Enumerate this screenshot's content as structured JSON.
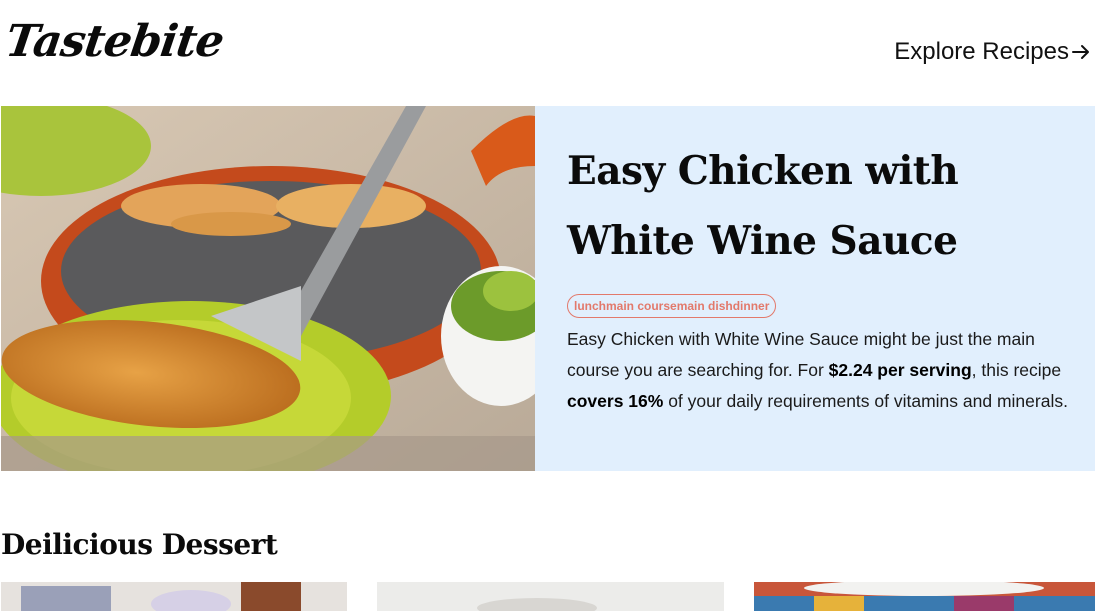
{
  "header": {
    "logo_text": "Tastebite",
    "explore_label": "Explore Recipes"
  },
  "hero": {
    "image_alt": "Chicken breast with white wine sauce on a green plate",
    "title": "Easy Chicken with White Wine Sauce",
    "tags": "lunchmain coursemain dishdinner",
    "summary": {
      "part1": "Easy Chicken with White Wine Sauce might be just the main course you are searching for. For ",
      "price": "$2.24 per serving",
      "part2": ", this recipe ",
      "covers": "covers 16%",
      "part3": " of your daily requirements of vitamins and minerals."
    }
  },
  "section": {
    "title": "Deilicious Dessert"
  },
  "colors": {
    "hero_panel": "#e1effd",
    "tag_accent": "#e2796b"
  },
  "icons": {
    "explore": "arrow-right-icon"
  }
}
